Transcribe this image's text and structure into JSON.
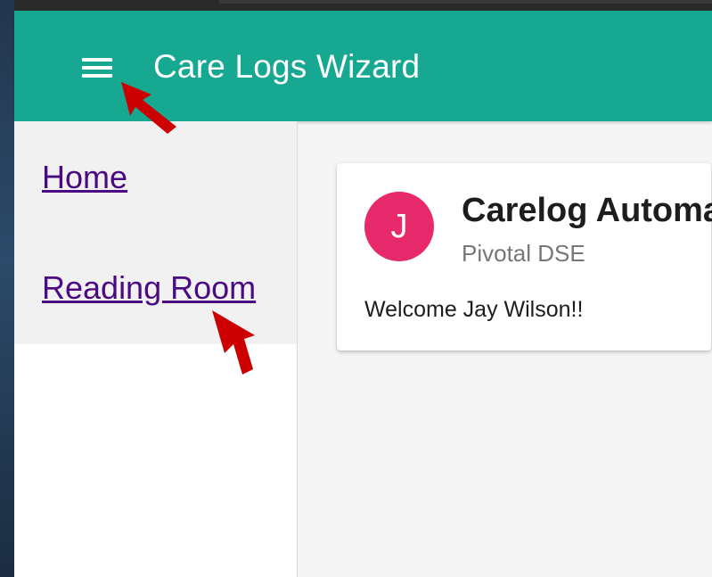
{
  "toolbar": {
    "title": "Care Logs Wizard",
    "menu_icon": "hamburger-menu-icon",
    "background_color": "#16a891"
  },
  "sidenav": {
    "items": [
      {
        "label": "Home"
      },
      {
        "label": "Reading Room"
      }
    ],
    "link_color": "#4b0a82"
  },
  "card": {
    "avatar_letter": "J",
    "avatar_color": "#e5296a",
    "title": "Carelog Automa",
    "subtitle": "Pivotal DSE",
    "content": "Welcome Jay Wilson!!"
  },
  "annotations": {
    "arrow_color": "#cc0000",
    "arrow_icon": "red-arrow-icon"
  }
}
